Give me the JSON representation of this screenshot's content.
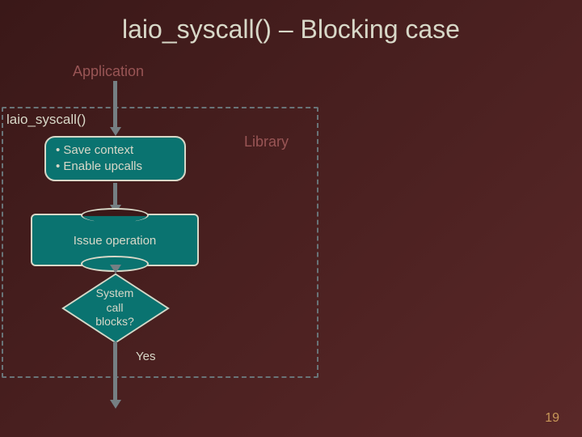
{
  "title": "laio_syscall() – Blocking case",
  "labels": {
    "application": "Application",
    "syscall": "laio_syscall()",
    "library": "Library",
    "yes": "Yes"
  },
  "boxes": {
    "save": {
      "line1": "• Save context",
      "line2": "• Enable upcalls"
    },
    "issue": "Issue operation",
    "decision": {
      "line1": "System",
      "line2": "call",
      "line3": "blocks?"
    }
  },
  "page_number": "19"
}
